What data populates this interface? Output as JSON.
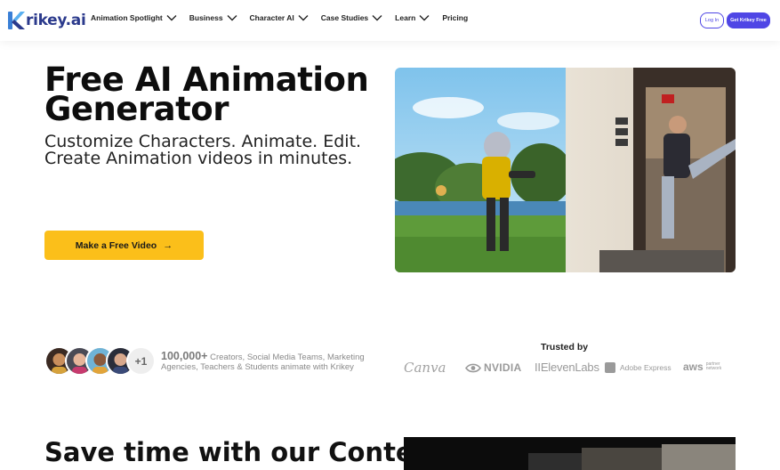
{
  "brand": {
    "name": "rikey.ai",
    "logo_icon": "krikey-k-logo",
    "accent": "#4f46e5",
    "logo_blue": "#2b3a8c"
  },
  "nav": {
    "items": [
      {
        "label": "Animation Spotlight",
        "dropdown": true
      },
      {
        "label": "Business",
        "dropdown": true
      },
      {
        "label": "Character AI",
        "dropdown": true
      },
      {
        "label": "Case Studies",
        "dropdown": true
      },
      {
        "label": "Learn",
        "dropdown": true
      },
      {
        "label": "Pricing",
        "dropdown": false
      }
    ],
    "login_label": "Log In",
    "cta_label": "Get Krikey Free"
  },
  "hero": {
    "title": "Free AI Animation Generator",
    "subtitle": "Customize Characters. Animate. Edit. Create Animation videos in minutes.",
    "button_label": "Make a Free Video",
    "button_icon": "arrow-right-icon",
    "button_color": "#fbbf1a"
  },
  "proof": {
    "more_label": "+1",
    "count": "100,000+",
    "text": " Creators, Social Media Teams, Marketing Agencies, Teachers & Students animate with Krikey"
  },
  "trusted": {
    "heading": "Trusted by",
    "brands": [
      {
        "name": "Canva"
      },
      {
        "name": "NVIDIA"
      },
      {
        "name": "IIElevenLabs"
      },
      {
        "name": "Adobe Express"
      },
      {
        "name": "aws",
        "sub": "partner network"
      }
    ]
  },
  "section2": {
    "title": "Save time with our Content"
  }
}
